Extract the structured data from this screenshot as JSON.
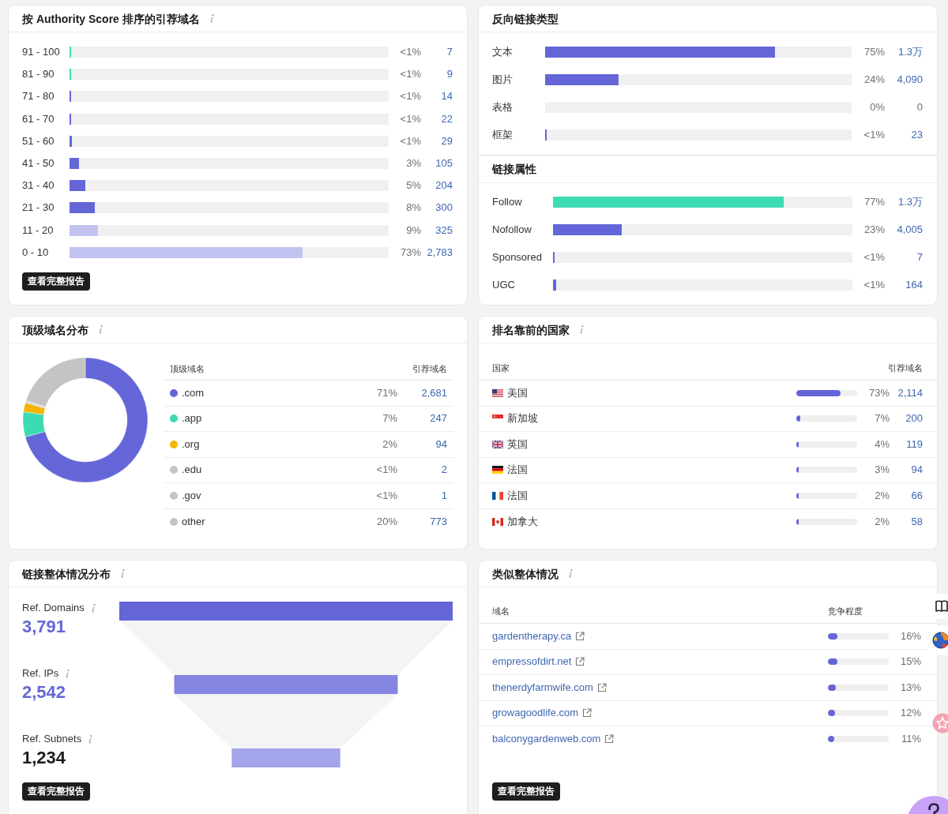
{
  "authority_card": {
    "title": "按 Authority Score 排序的引荐域名",
    "rows": [
      {
        "label": "91 - 100",
        "level": 0.006,
        "color": "#3ddbb4",
        "percent": "<1%",
        "count": "7"
      },
      {
        "label": "81 - 90",
        "level": 0.006,
        "color": "#3ddbb4",
        "percent": "<1%",
        "count": "9"
      },
      {
        "label": "71 - 80",
        "level": 0.006,
        "color": "#6466d8",
        "percent": "<1%",
        "count": "14"
      },
      {
        "label": "61 - 70",
        "level": 0.006,
        "color": "#6466d8",
        "percent": "<1%",
        "count": "22"
      },
      {
        "label": "51 - 60",
        "level": 0.008,
        "color": "#6466d8",
        "percent": "<1%",
        "count": "29"
      },
      {
        "label": "41 - 50",
        "level": 0.03,
        "color": "#6466d8",
        "percent": "3%",
        "count": "105"
      },
      {
        "label": "31 - 40",
        "level": 0.05,
        "color": "#6466d8",
        "percent": "5%",
        "count": "204"
      },
      {
        "label": "21 - 30",
        "level": 0.08,
        "color": "#6466d8",
        "percent": "8%",
        "count": "300"
      },
      {
        "label": "11 - 20",
        "level": 0.09,
        "color": "#c1c2f0",
        "percent": "9%",
        "count": "325"
      },
      {
        "label": "0 - 10",
        "level": 0.73,
        "color": "#c1c2f0",
        "percent": "73%",
        "count": "2,783"
      }
    ],
    "button": "查看完整报告"
  },
  "backlink_types_card": {
    "title": "反向链接类型",
    "rows": [
      {
        "label": "文本",
        "level": 0.75,
        "percent": "75%",
        "count": "1.3万",
        "linked": true
      },
      {
        "label": "图片",
        "level": 0.24,
        "percent": "24%",
        "count": "4,090",
        "linked": true
      },
      {
        "label": "表格",
        "percent": "0%",
        "count": "0",
        "linked": false
      },
      {
        "label": "框架",
        "level": 0.005,
        "percent": "<1%",
        "count": "23",
        "linked": true
      }
    ]
  },
  "link_attributes_section": {
    "title": "链接属性",
    "rows": [
      {
        "label": "Follow",
        "level": 0.77,
        "color": "#3ddbb4",
        "percent": "77%",
        "count": "1.3万"
      },
      {
        "label": "Nofollow",
        "level": 0.23,
        "color": "#6466d8",
        "percent": "23%",
        "count": "4,005"
      },
      {
        "label": "Sponsored",
        "level": 0.005,
        "color": "#6466d8",
        "percent": "<1%",
        "count": "7"
      },
      {
        "label": "UGC",
        "level": 0.01,
        "color": "#6466d8",
        "percent": "<1%",
        "count": "164"
      }
    ]
  },
  "tld_card": {
    "title": "顶级域名分布",
    "chart_data": {
      "type": "donut",
      "values": [
        70.6,
        6.5,
        2.4,
        0.3,
        0.3,
        19.9
      ]
    },
    "columns": [
      "顶级域名",
      "引荐域名"
    ],
    "rows": [
      {
        "name": ".com",
        "color": "#6466d8",
        "percent": "71%",
        "count": "2,681"
      },
      {
        "name": ".app",
        "color": "#3ddbb4",
        "percent": "7%",
        "count": "247"
      },
      {
        "name": ".org",
        "color": "#f5b400",
        "percent": "2%",
        "count": "94"
      },
      {
        "name": ".edu",
        "color": "#c4c4c4",
        "percent": "<1%",
        "count": "2"
      },
      {
        "name": ".gov",
        "color": "#c4c4c4",
        "percent": "<1%",
        "count": "1"
      },
      {
        "name": "other",
        "color": "#c4c4c4",
        "percent": "20%",
        "count": "773"
      }
    ]
  },
  "countries_card": {
    "title": "排名靠前的国家",
    "columns": [
      "国家",
      "引荐域名"
    ],
    "rows": [
      {
        "kind": "us",
        "name": "美国",
        "level": 0.73,
        "percent": "73%",
        "count": "2,114"
      },
      {
        "kind": "sg",
        "name": "新加坡",
        "level": 0.07,
        "percent": "7%",
        "count": "200"
      },
      {
        "kind": "gb",
        "name": "英国",
        "level": 0.04,
        "percent": "4%",
        "count": "119"
      },
      {
        "kind": "de",
        "name": "法国",
        "level": 0.03,
        "percent": "3%",
        "count": "94"
      },
      {
        "kind": "fr",
        "name": "法国",
        "level": 0.02,
        "percent": "2%",
        "count": "66"
      },
      {
        "kind": "ca",
        "name": "加拿大",
        "level": 0.02,
        "percent": "2%",
        "count": "58"
      }
    ]
  },
  "overview_card": {
    "title": "链接整体情况分布",
    "metrics": [
      {
        "label": "Ref. Domains",
        "value": "3,791",
        "highlighted": true,
        "color": "#6466d8"
      },
      {
        "label": "Ref. IPs",
        "value": "2,542",
        "highlighted": true,
        "color": "#8385e0"
      },
      {
        "label": "Ref. Subnets",
        "value": "1,234",
        "highlighted": false,
        "color": "#a3a4ea"
      }
    ],
    "button": "查看完整报告"
  },
  "similar_card": {
    "title": "类似整体情况",
    "columns": [
      "域名",
      "竞争程度"
    ],
    "rows": [
      {
        "domain": "gardentherapy.ca",
        "level": 0.16,
        "percent": "16%"
      },
      {
        "domain": "empressofdirt.net",
        "level": 0.15,
        "percent": "15%"
      },
      {
        "domain": "thenerdyfarmwife.com",
        "level": 0.13,
        "percent": "13%"
      },
      {
        "domain": "growagoodlife.com",
        "level": 0.12,
        "percent": "12%"
      },
      {
        "domain": "balconygardenweb.com",
        "level": 0.11,
        "percent": "11%"
      }
    ],
    "button": "查看完整报告"
  }
}
